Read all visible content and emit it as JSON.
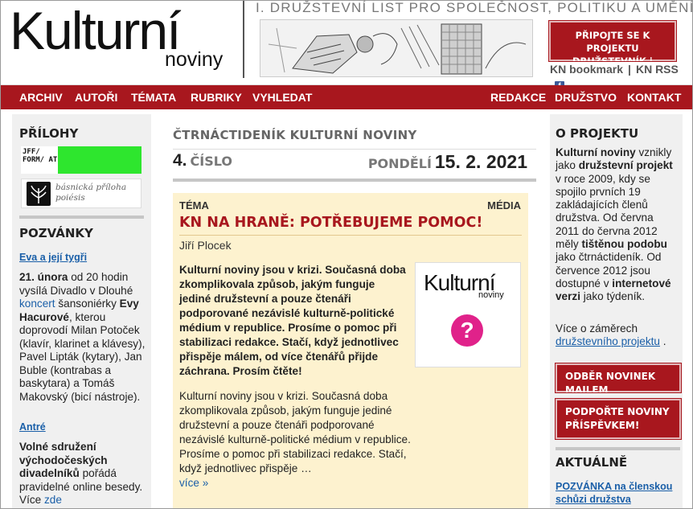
{
  "header": {
    "logo_main": "Kulturní",
    "logo_sub": "noviny",
    "tagline": "I. DRUŽSTEVNÍ LIST PRO SPOLEČNOST, POLITIKU A UMĚNÍ",
    "join_line1": "PŘIPOJTE SE K PROJEKTU",
    "join_line2": "DRUŽSTEVNÍK | SPONZOR",
    "kn_bookmark": "KN bookmark",
    "kn_sep": "|",
    "kn_rss": "KN RSS",
    "fb_glyph": "f"
  },
  "nav": {
    "items": [
      "ARCHIV",
      "AUTOŘI",
      "TÉMATA",
      "RUBRIKY",
      "VYHLEDAT"
    ],
    "right_items": [
      "REDAKCE",
      "DRUŽSTVO",
      "KONTAKT"
    ]
  },
  "left": {
    "prilohy_title": "PŘÍLOHY",
    "jff_text": "JFF/ FORM/ AT",
    "poiesis_text": "básnická příloha poiésis",
    "pozvanky_title": "POZVÁNKY",
    "event1_link": "Eva a její tygři",
    "event1_strong": "21. února",
    "event1_a": " od 20 hodin vysílá Divadlo v Dlouhé ",
    "event1_koncert": "koncert",
    "event1_b": " šansoniérky ",
    "event1_name": "Evy Hacurové",
    "event1_c": ", kterou doprovodí Milan Potoček (klavír, klarinet a klávesy), Pavel Lipták (kytary), Jan Buble (kontrabas a baskytara) a Tomáš Makovský (bicí nástroje).",
    "event2_link": "Antré",
    "event2_strong": "Volné sdružení východočeských divadelníků",
    "event2_a": " pořádá pravidelné online besedy. Více ",
    "event2_zde": "zde"
  },
  "center": {
    "kicker": "ČTRNÁCTIDENÍK KULTURNÍ NOVINY",
    "issue_num": "4.",
    "issue_label": "ČÍSLO",
    "day": "PONDĚLÍ",
    "date": "15. 2. 2021",
    "article": {
      "category": "TÉMA",
      "media": "MÉDIA",
      "title": "KN NA HRANĚ: POTŘEBUJEME POMOC!",
      "author": "Jiří Plocek",
      "lead": "Kulturní noviny jsou v krizi. Současná doba zkomplikovala způsob, jakým funguje jediné družstevní a pouze čtenáři podporované nezávislé kulturně-politické médium v republice. Prosíme o pomoc při stabilizaci redakce. Stačí, když jednotlivec přispěje málem, od více čtenářů přijde záchrana. Prosím čtěte!",
      "body": "Kulturní noviny jsou v krizi. Současná doba zkomplikovala způsob, jakým funguje jediné družstevní a pouze čtenáři podporované nezávislé kulturně-politické médium v republice. Prosíme o pomoc při stabilizaci redakce. Stačí, když jednotlivec přispěje …",
      "more": "více »",
      "image_logo_main": "Kulturní",
      "image_logo_sub": "noviny",
      "image_q": "?"
    }
  },
  "right": {
    "about_title": "O PROJEKTU",
    "about_a_strong": "Kulturní noviny",
    "about_a": " vznikly jako ",
    "about_b_strong": "družstevní projekt",
    "about_b": " v roce 2009, kdy se spojilo prvních 19 zakládajících členů družstva. Od června 2011 do června 2012 měly ",
    "about_c_strong": "tištěnou podobu",
    "about_c": " jako čtrnáctideník. Od července 2012 jsou dostupné v ",
    "about_d_strong": "internetové verzi",
    "about_d": " jako týdeník.",
    "more_a": "Více o záměrech ",
    "more_link": "družstevního projektu",
    "more_b": " .",
    "btn_newsletter": "ODBĚR NOVINEK MAILEM",
    "btn_support_1": "PODPOŘTE NOVINY",
    "btn_support_2": "PŘÍSPĚVKEM!",
    "aktualne_title": "AKTUÁLNĚ",
    "aktualne_link": "POZVÁNKA na členskou schůzi družstva"
  },
  "colors": {
    "brand_red": "#a8171e",
    "link_blue": "#1a5fa8",
    "article_bg": "#fdf2cf",
    "sidebar_bg": "#f0f0f0",
    "jff_green": "#2ee62e",
    "question_pink": "#e0228a"
  }
}
